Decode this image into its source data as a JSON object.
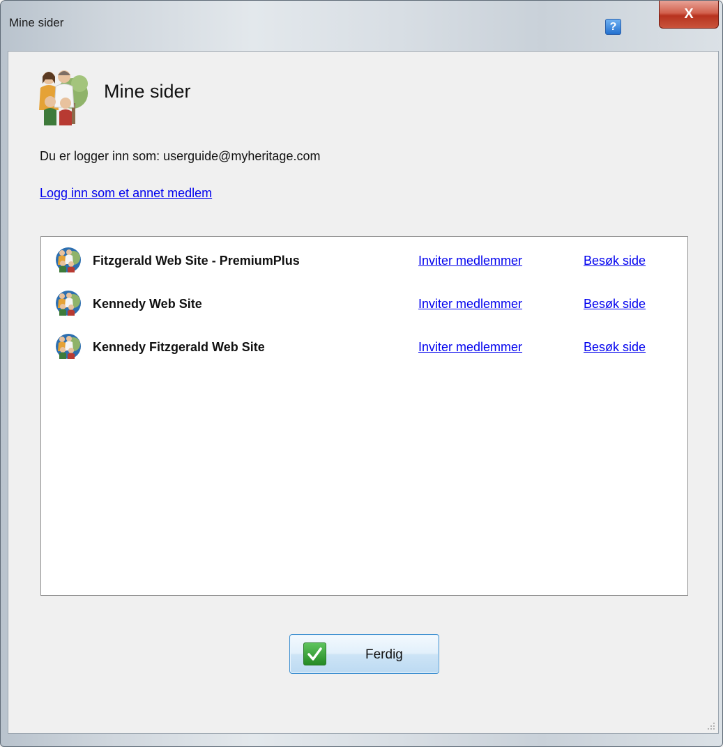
{
  "window": {
    "title": "Mine sider",
    "help_label": "?",
    "close_label": "X"
  },
  "header": {
    "title": "Mine sider"
  },
  "logged_in_text": "Du er logger inn som: userguide@myheritage.com",
  "login_other_link": "Logg inn som et annet medlem",
  "sites": [
    {
      "name": "Fitzgerald Web Site - PremiumPlus",
      "invite_label": "Inviter medlemmer",
      "visit_label": "Besøk side"
    },
    {
      "name": "Kennedy Web Site",
      "invite_label": "Inviter medlemmer",
      "visit_label": "Besøk side"
    },
    {
      "name": "Kennedy Fitzgerald Web Site",
      "invite_label": "Inviter medlemmer",
      "visit_label": "Besøk side"
    }
  ],
  "done_button": {
    "label": "Ferdig",
    "icon": "checkmark-icon"
  },
  "colors": {
    "link": "#0000ee",
    "close_button": "#c5432d",
    "help_button": "#2370cf",
    "check_green": "#2e962e"
  }
}
